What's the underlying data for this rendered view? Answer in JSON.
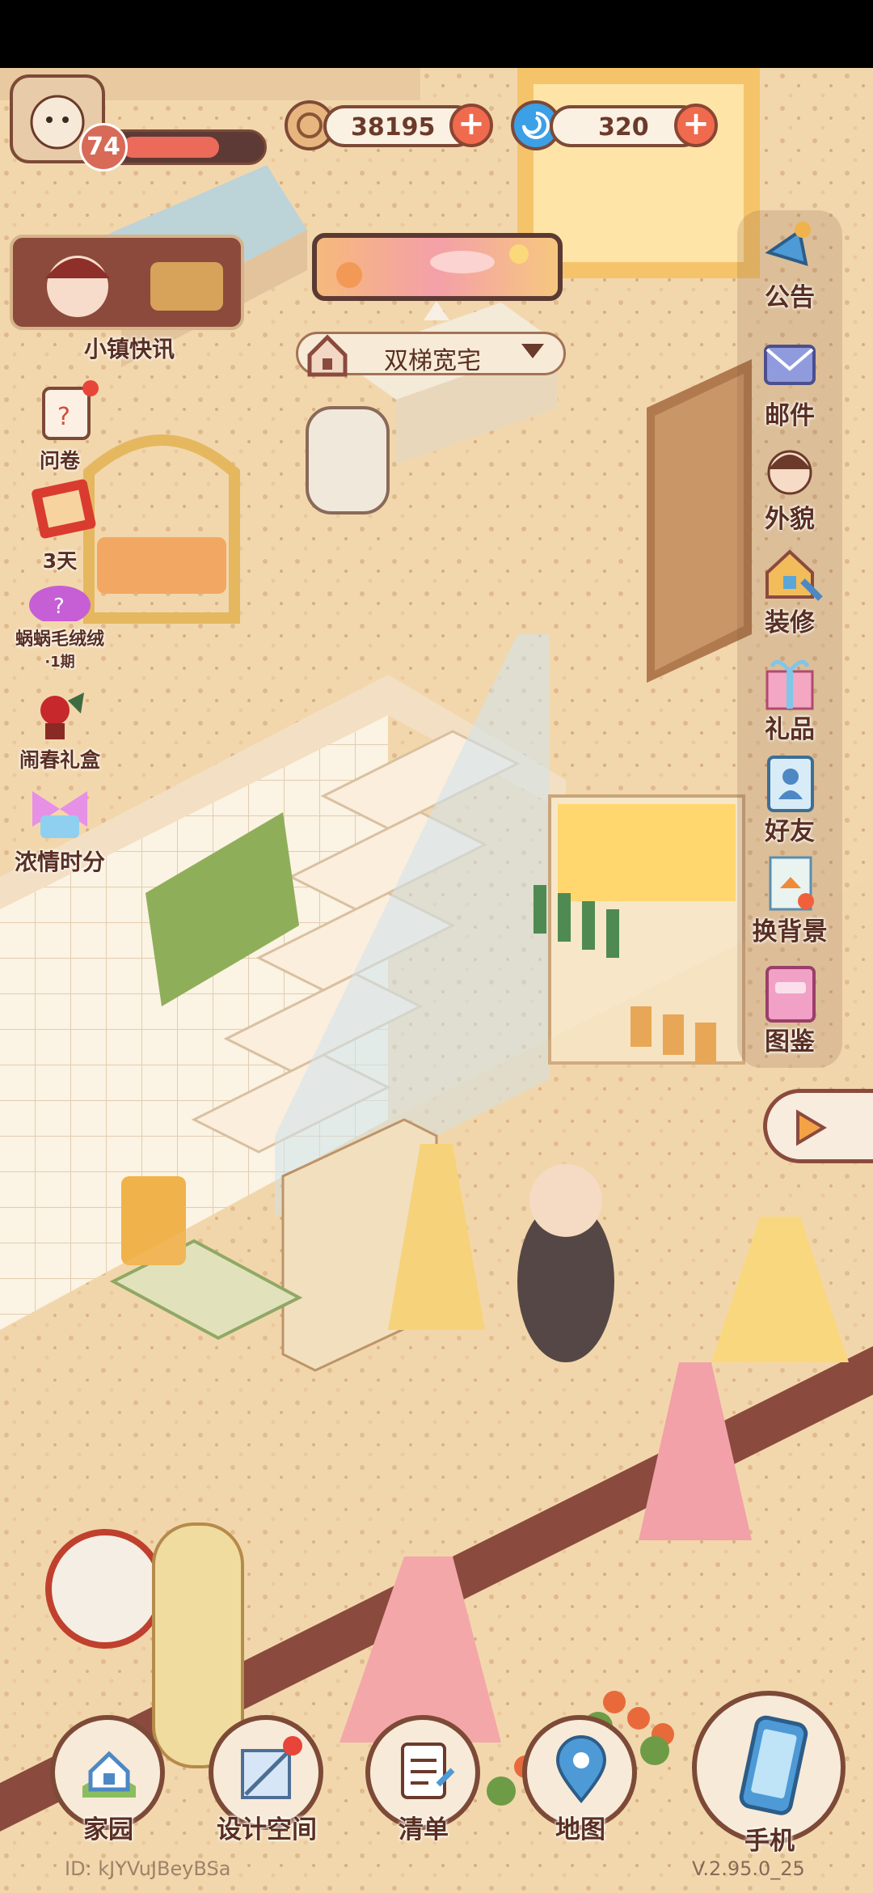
{
  "player": {
    "level": "74",
    "avatar_icon": "player-avatar-icon"
  },
  "currency": {
    "coins": "38195",
    "gems": "320"
  },
  "news": {
    "label": "小镇快讯"
  },
  "house": {
    "name": "双梯宽宅"
  },
  "left_menu": [
    {
      "label": "问卷",
      "icon": "survey-icon"
    },
    {
      "label": "3天",
      "icon": "calendar-event-icon"
    },
    {
      "label": "蜗蜗毛绒绒",
      "sub": "·1期",
      "icon": "plush-gacha-icon"
    },
    {
      "label": "闹春礼盒",
      "icon": "spring-gift-box-icon"
    },
    {
      "label": "浓情时分",
      "icon": "bow-event-icon"
    }
  ],
  "right_menu": [
    {
      "label": "公告",
      "icon": "megaphone-icon"
    },
    {
      "label": "邮件",
      "icon": "mail-icon"
    },
    {
      "label": "外貌",
      "icon": "appearance-icon"
    },
    {
      "label": "装修",
      "icon": "decorate-icon"
    },
    {
      "label": "礼品",
      "icon": "gift-icon"
    },
    {
      "label": "好友",
      "icon": "friends-icon"
    },
    {
      "label": "换背景",
      "icon": "background-icon"
    },
    {
      "label": "图鉴",
      "icon": "album-icon"
    }
  ],
  "bottom_nav": [
    {
      "label": "家园",
      "icon": "home-icon"
    },
    {
      "label": "设计空间",
      "icon": "design-icon"
    },
    {
      "label": "清单",
      "icon": "list-icon"
    },
    {
      "label": "地图",
      "icon": "map-pin-icon"
    },
    {
      "label": "手机",
      "icon": "phone-icon"
    }
  ],
  "footer": {
    "id": "ID: kJYVuJBeyBSa",
    "version": "V.2.95.0_25"
  },
  "colors": {
    "accent": "#f06a4e",
    "outline": "#7d4a37",
    "text": "#5a2f22"
  }
}
